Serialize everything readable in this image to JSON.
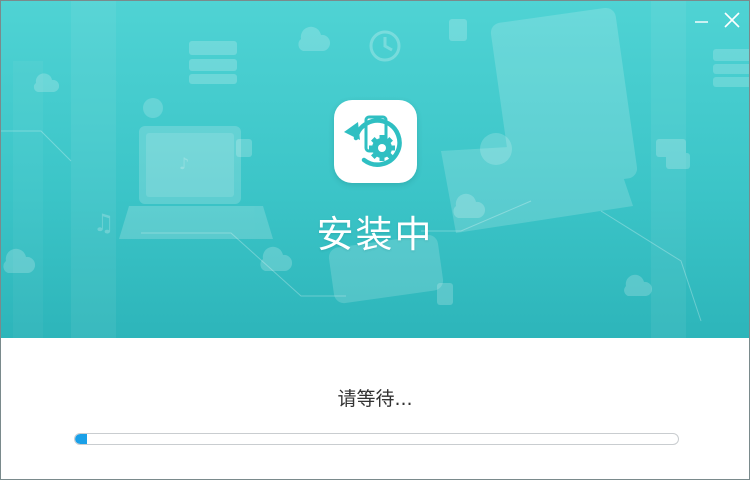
{
  "window": {
    "minimize_icon": "minimize-icon",
    "close_icon": "close-icon"
  },
  "banner": {
    "app_icon": "sync-phone-gear-icon",
    "title": "安装中"
  },
  "status": {
    "text": "请等待..."
  },
  "progress": {
    "percent": 2
  },
  "colors": {
    "banner_top": "#4fd3d4",
    "banner_bottom": "#2db5ba",
    "accent": "#1aa0e8",
    "icon_teal": "#2fbfc2"
  }
}
